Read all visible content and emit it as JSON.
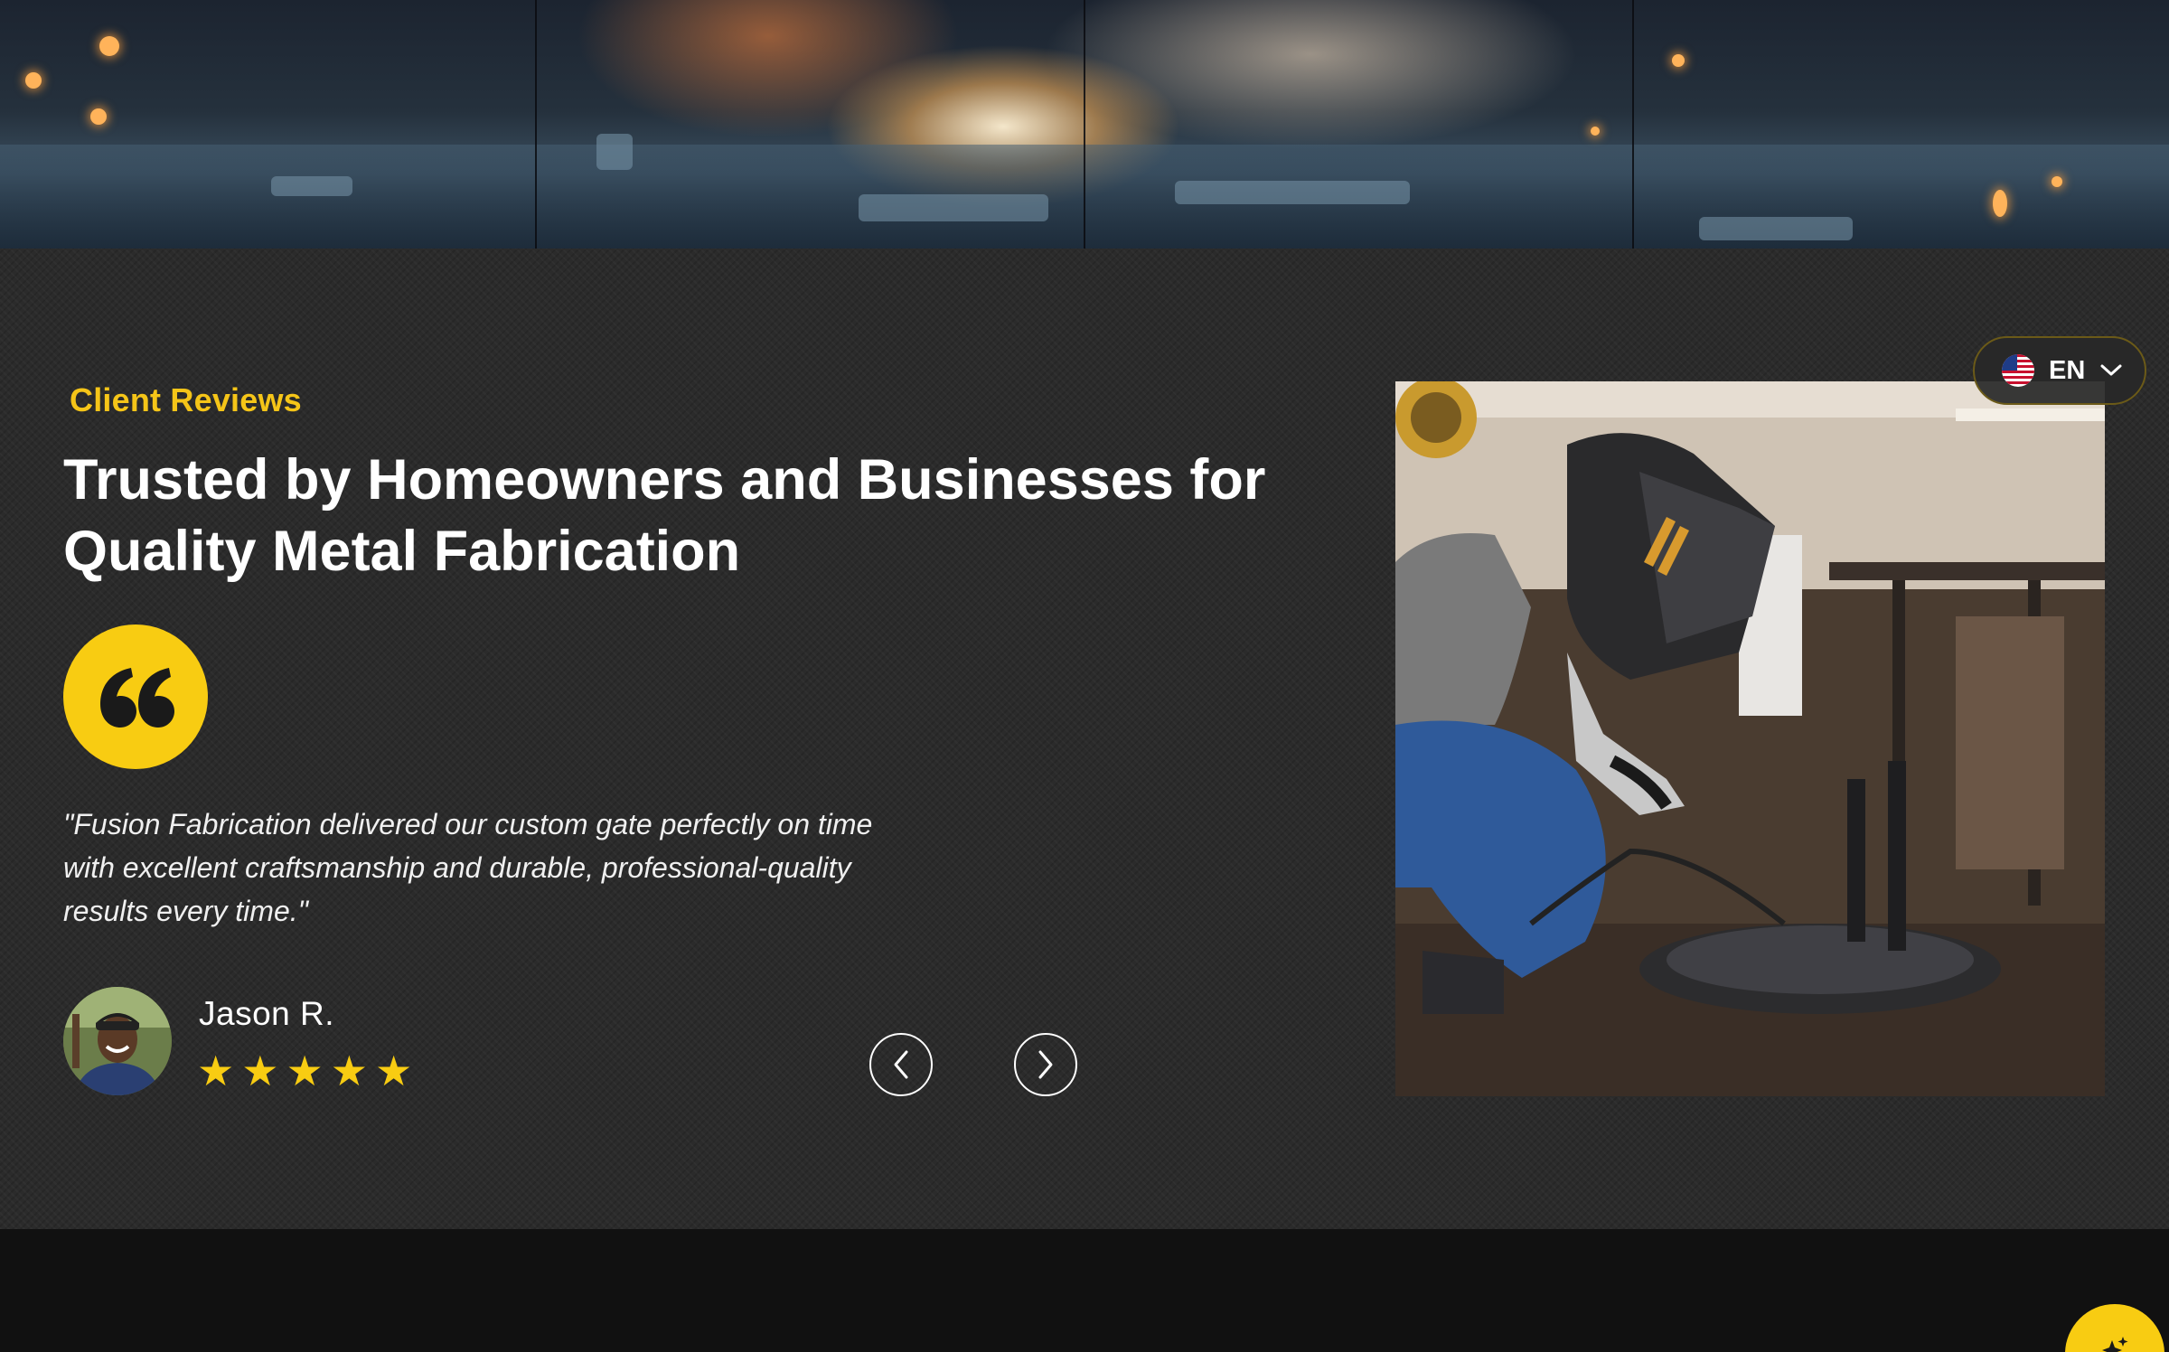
{
  "reviews": {
    "eyebrow": "Client Reviews",
    "headline": "Trusted by Homeowners and Businesses for Quality Metal Fabrication",
    "quote_icon": "quote-icon",
    "testimonial": "\"Fusion Fabrication delivered our custom gate perfectly on time with excellent craftsmanship and durable, professional-quality results every time.\"",
    "reviewer": {
      "name": "Jason R.",
      "rating": 5,
      "stars": [
        "★",
        "★",
        "★",
        "★",
        "★"
      ]
    },
    "nav": {
      "prev_icon": "chevron-left-icon",
      "next_icon": "chevron-right-icon"
    }
  },
  "language": {
    "code": "EN",
    "flag_icon": "us-flag-icon",
    "dropdown_icon": "chevron-down-icon"
  },
  "colors": {
    "accent": "#f8cc12",
    "section_bg": "#2b2b2b",
    "footer_bg": "#111111",
    "text": "#ffffff"
  }
}
